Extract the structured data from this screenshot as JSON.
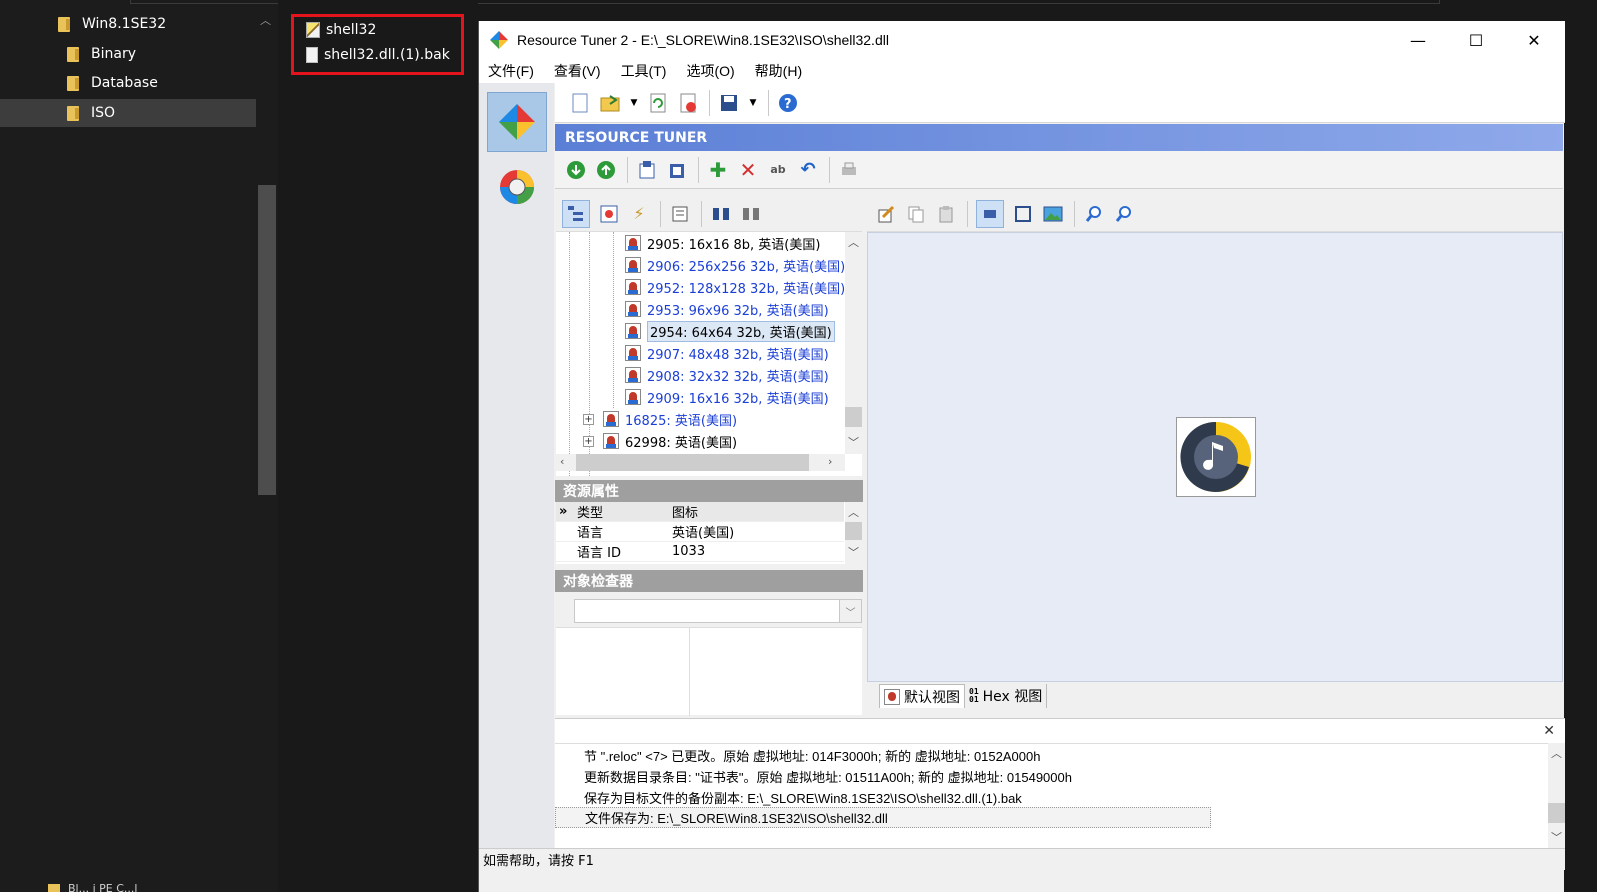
{
  "explorer": {
    "nav_items": [
      {
        "label": "Win8.1SE32"
      },
      {
        "label": "Binary"
      },
      {
        "label": "Database"
      },
      {
        "label": "ISO"
      }
    ],
    "bottom_item": "Bl... i PE C...l",
    "files": [
      {
        "label": "shell32"
      },
      {
        "label": "shell32.dll.(1).bak"
      }
    ]
  },
  "window": {
    "title": "Resource Tuner 2 - E:\\_SLORE\\Win8.1SE32\\ISO\\shell32.dll",
    "minimize": "—",
    "maximize": "☐",
    "close": "✕"
  },
  "menu": [
    "文件(F)",
    "查看(V)",
    "工具(T)",
    "选项(O)",
    "帮助(H)"
  ],
  "banner": "RESOURCE TUNER",
  "tree": {
    "rows": [
      {
        "label": "2905: 16x16 8b, 英语(美国)",
        "blue": false
      },
      {
        "label": "2906: 256x256 32b, 英语(美国)",
        "blue": true
      },
      {
        "label": "2952: 128x128 32b, 英语(美国)",
        "blue": true
      },
      {
        "label": "2953: 96x96 32b, 英语(美国)",
        "blue": true
      },
      {
        "label": "2954: 64x64 32b, 英语(美国)",
        "blue": false,
        "selected": true
      },
      {
        "label": "2907: 48x48 32b, 英语(美国)",
        "blue": true
      },
      {
        "label": "2908: 32x32 32b, 英语(美国)",
        "blue": true
      },
      {
        "label": "2909: 16x16 32b, 英语(美国)",
        "blue": true
      },
      {
        "label": "16825: 英语(美国)",
        "blue": true
      },
      {
        "label": "62998: 英语(美国)",
        "blue": false
      }
    ]
  },
  "properties": {
    "header": "资源属性",
    "rows": [
      {
        "key": "类型",
        "value": "图标"
      },
      {
        "key": "语言",
        "value": "英语(美国)"
      },
      {
        "key": "语言 ID",
        "value": "1033"
      }
    ]
  },
  "inspector": {
    "header": "对象检查器"
  },
  "view_tabs": [
    "默认视图",
    "Hex 视图"
  ],
  "log": [
    "节 \".reloc\" <7> 已更改。原始 虚拟地址: 014F3000h; 新的 虚拟地址: 0152A000h",
    "更新数据目录条目: \"证书表\"。原始 虚拟地址: 01511A00h; 新的 虚拟地址: 01549000h",
    "保存为目标文件的备份副本: E:\\_SLORE\\Win8.1SE32\\ISO\\shell32.dll.(1).bak",
    "文件保存为: E:\\_SLORE\\Win8.1SE32\\ISO\\shell32.dll"
  ],
  "status": "如需帮助，请按 F1",
  "colors": {
    "banner": "#5b7fd6",
    "highlight": "#e3141b",
    "link_blue": "#1b3fd6"
  }
}
